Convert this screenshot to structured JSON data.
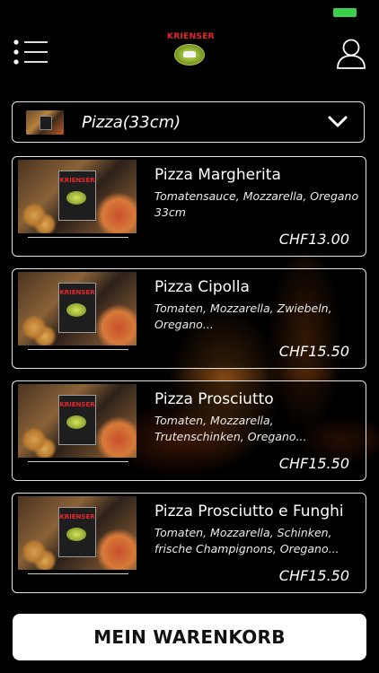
{
  "header": {
    "logo_text": "KRIENSER"
  },
  "category": {
    "selected": "Pizza(33cm)"
  },
  "items": [
    {
      "name": "Pizza Margherita",
      "description": "Tomatensauce, Mozzarella, Oregano 33cm",
      "price": "CHF13.00",
      "thumb_text": "KRIENSER"
    },
    {
      "name": "Pizza Cipolla",
      "description": "Tomaten, Mozzarella, Zwiebeln, Oregano...",
      "price": "CHF15.50",
      "thumb_text": "KRIENSER"
    },
    {
      "name": "Pizza Prosciutto",
      "description": "Tomaten, Mozzarella, Trutenschinken, Oregano...",
      "price": "CHF15.50",
      "thumb_text": "KRIENSER"
    },
    {
      "name": "Pizza Prosciutto e Funghi",
      "description": "Tomaten, Mozzarella, Schinken, frische Champignons, Oregano...",
      "price": "CHF15.50",
      "thumb_text": "KRIENSER"
    }
  ],
  "cart": {
    "label": "MEIN WARENKORB"
  },
  "icons": {
    "menu": "menu-list-icon",
    "user": "user-icon",
    "dropdown": "chevron-down-icon"
  },
  "colors": {
    "background": "#000000",
    "border": "#e6e6e6",
    "logo_red": "#e8262c",
    "battery": "#3ccf4e",
    "button": "#ffffff"
  }
}
